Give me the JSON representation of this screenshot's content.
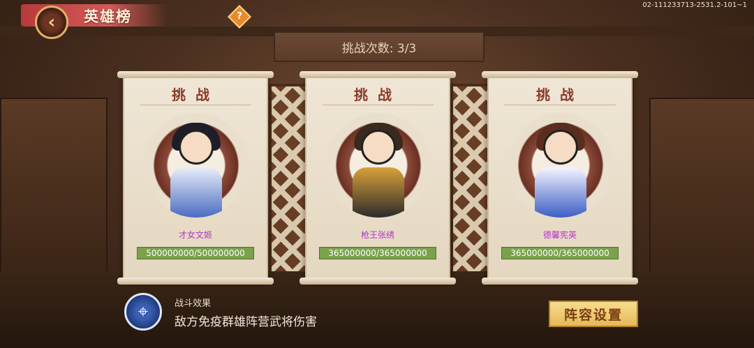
{
  "header": {
    "back_icon": "chevron-left-icon",
    "title": "英雄榜",
    "help_label": "?",
    "version": "02-111233713-2531.2-101~1"
  },
  "attempts": "挑战次数: 3/3",
  "cards": [
    {
      "title": "挑战",
      "name": "才女文姬",
      "hp": "500000000/500000000",
      "hp_fraction": 1.0
    },
    {
      "title": "挑战",
      "name": "枪王张绣",
      "hp": "365000000/365000000",
      "hp_fraction": 1.0
    },
    {
      "title": "挑战",
      "name": "德馨宪英",
      "hp": "365000000/365000000",
      "hp_fraction": 1.0
    }
  ],
  "effect": {
    "icon": "crosshair-icon",
    "label": "战斗效果",
    "description": "敌方免疫群雄阵营武将伤害"
  },
  "lineup_button": "阵容设置",
  "colors": {
    "name_text": "#b535c8",
    "hp_bar": "#7aa14c",
    "title_text": "#8a3a2a"
  }
}
